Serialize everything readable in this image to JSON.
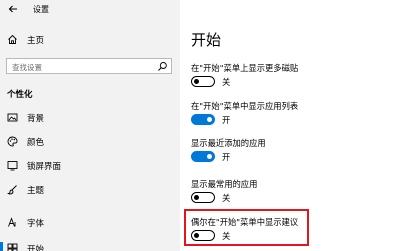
{
  "window": {
    "title": "设置"
  },
  "sidebar": {
    "home_label": "主页",
    "search_placeholder": "查找设置",
    "section_title": "个性化",
    "items": [
      {
        "label": "背景",
        "icon": "picture-icon"
      },
      {
        "label": "颜色",
        "icon": "palette-icon"
      },
      {
        "label": "锁屏界面",
        "icon": "lock-screen-icon"
      },
      {
        "label": "主题",
        "icon": "brush-icon"
      },
      {
        "label": "字体",
        "icon": "font-icon"
      },
      {
        "label": "开始",
        "icon": "start-icon",
        "active": true
      }
    ]
  },
  "main": {
    "page_title": "开始",
    "settings": [
      {
        "label": "在\"开始\"菜单上显示更多磁贴",
        "state": "关",
        "on": false
      },
      {
        "label": "在\"开始\"菜单中显示应用列表",
        "state": "开",
        "on": true
      },
      {
        "label": "显示最近添加的应用",
        "state": "开",
        "on": true
      },
      {
        "label": "显示最常用的应用",
        "state": "关",
        "on": false
      },
      {
        "label": "偶尔在\"开始\"菜单中显示建议",
        "state": "关",
        "on": false
      }
    ]
  },
  "colors": {
    "accent": "#0078d7",
    "highlight": "#e3161d"
  }
}
